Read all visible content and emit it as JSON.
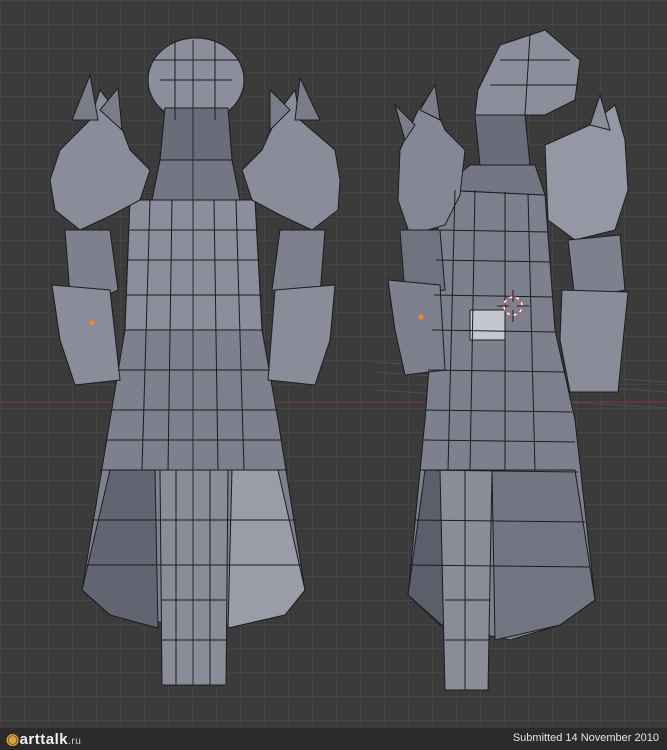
{
  "watermark": {
    "brand": "arttalk",
    "suffix": ".ru"
  },
  "footer": {
    "submitted": "Submitted 14 November 2010"
  },
  "colors": {
    "viewport_bg": "#3b3b3b",
    "grid_line": "#444444",
    "mesh_fill": "#7e808d",
    "mesh_light": "#a4a6b2",
    "mesh_dark": "#565866",
    "wire": "#1c1c22",
    "x_axis": "#7a3a3a",
    "vertex_selected": "#f08a28"
  },
  "icons": {
    "cursor": "3d-cursor-icon"
  }
}
